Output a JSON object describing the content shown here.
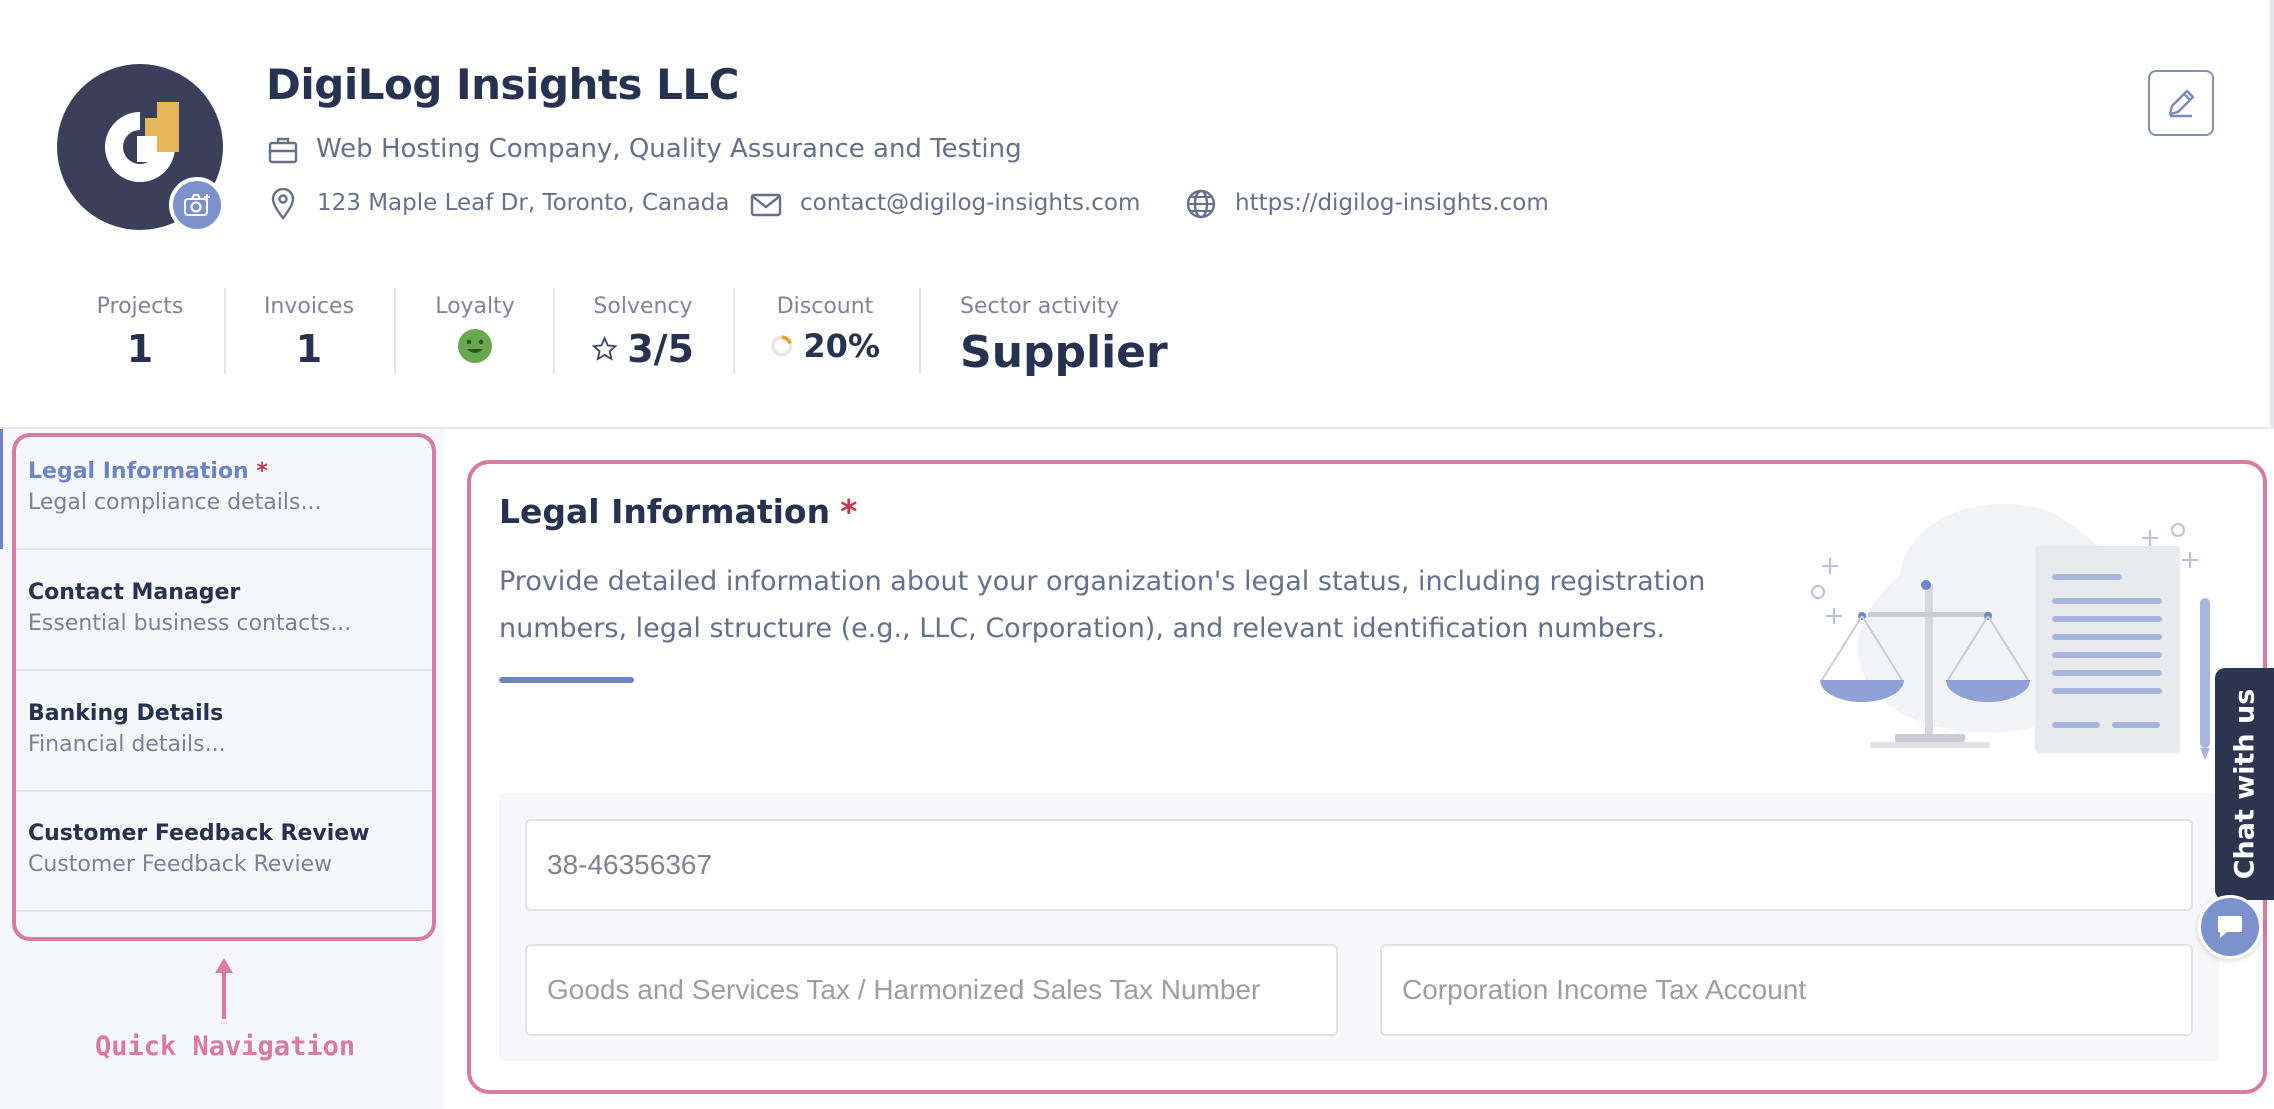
{
  "company": {
    "name": "DigiLog Insights LLC",
    "tagline": "Web Hosting Company, Quality Assurance and Testing",
    "address": "123 Maple Leaf Dr, Toronto, Canada",
    "email": "contact@digilog-insights.com",
    "website": "https://digilog-insights.com"
  },
  "stats": {
    "projects": {
      "label": "Projects",
      "value": "1"
    },
    "invoices": {
      "label": "Invoices",
      "value": "1"
    },
    "loyalty": {
      "label": "Loyalty",
      "icon": "smiley-icon"
    },
    "solvency": {
      "label": "Solvency",
      "value": "3/5",
      "icon": "star-icon"
    },
    "discount": {
      "label": "Discount",
      "value": "20%",
      "percent": 20
    },
    "sector": {
      "label": "Sector activity",
      "value": "Supplier"
    }
  },
  "sidebar": {
    "items": [
      {
        "title": "Legal Information",
        "required": "*",
        "subtitle": "Legal compliance details..."
      },
      {
        "title": "Contact Manager",
        "subtitle": "Essential business contacts..."
      },
      {
        "title": "Banking Details",
        "subtitle": "Financial details..."
      },
      {
        "title": "Customer Feedback Review",
        "subtitle": "Customer Feedback Review"
      }
    ],
    "annotation": "Quick Navigation"
  },
  "main": {
    "title": "Legal Information",
    "required": "*",
    "description": "Provide detailed information about your organization's legal status, including registration numbers, legal structure (e.g., LLC, Corporation), and relevant identification numbers.",
    "fields": {
      "business_number": {
        "value": "38-46356367"
      },
      "gst_hst": {
        "placeholder": "Goods and Services Tax / Harmonized Sales Tax Number"
      },
      "corp_income_tax": {
        "placeholder": "Corporation Income Tax Account"
      }
    }
  },
  "chat": {
    "label": "Chat with us"
  },
  "colors": {
    "accent": "#6d85c6",
    "navy": "#26324f",
    "highlight": "#d97aa2",
    "logo_gold": "#e8b65a"
  }
}
